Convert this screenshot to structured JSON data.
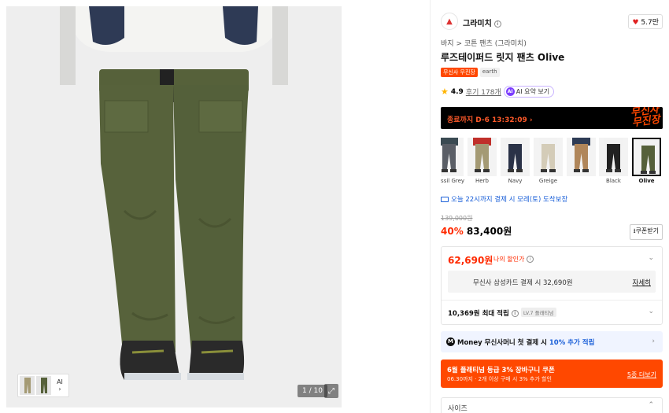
{
  "gallery": {
    "counter": "1 / 10",
    "ai_label": "AI"
  },
  "brand": {
    "name": "그라미치",
    "likes": "5.7만"
  },
  "breadcrumb": {
    "cat1": "바지",
    "sep": ">",
    "cat2": "코튼 팬츠 (그라미치)"
  },
  "product": {
    "title": "루즈테이퍼드 릿지 팬츠 Olive",
    "tags": [
      "무신사 무진장",
      "earth"
    ]
  },
  "rating": {
    "score": "4.9",
    "reviews": "후기 178개",
    "ai_summary": "AI 요약 보기"
  },
  "banner": {
    "text": "종료까지 D-6 13:32:09 ›",
    "logo_line1": "무신사",
    "logo_line2": "무진장"
  },
  "colors": {
    "items": [
      {
        "label": "Fossil Grey",
        "color": "#5a5e66",
        "top": "#3a4a52"
      },
      {
        "label": "Herb",
        "color": "#a49a74",
        "top": "#c0302b"
      },
      {
        "label": "Navy",
        "color": "#2a3247",
        "top": "#f2f2f2"
      },
      {
        "label": "Greige",
        "color": "#d4ccb8",
        "top": "#f2f2f2"
      },
      {
        "label": "",
        "color": "#b0865a",
        "top": "#2e3c55"
      },
      {
        "label": "Black",
        "color": "#222",
        "top": "#f2f2f2"
      },
      {
        "label": "Olive",
        "color": "#56613a",
        "top": "#f2f2f2"
      }
    ],
    "selected": "Olive"
  },
  "delivery": "오늘 22시까지 결제 시 모레(토) 도착보장",
  "price": {
    "original": "139,000원",
    "discount": "40%",
    "current": "83,400원",
    "coupon_btn": "쿠폰받기"
  },
  "my_price": {
    "value": "62,690원",
    "label": "나의 할인가",
    "card_text": "무신사 삼성카드 결제 시 32,690원",
    "card_link": "자세히",
    "points": "10,369원 최대 적립",
    "level": "LV.7 플래티넘"
  },
  "money": {
    "brand": "Money",
    "text": "무신사머니 첫 결제 시",
    "highlight": "10% 추가 적립"
  },
  "promo": {
    "title": "6월 플래티넘 등급 3% 장바구니 쿠폰",
    "sub": "06.30까지 · 2개 이상 구매 시 3% 추가 할인",
    "link": "5종 더보기"
  },
  "size": {
    "label": "사이즈"
  },
  "accent": {
    "red": "#ff2a00",
    "orange": "#ff4800",
    "blue": "#1a5fd8"
  }
}
